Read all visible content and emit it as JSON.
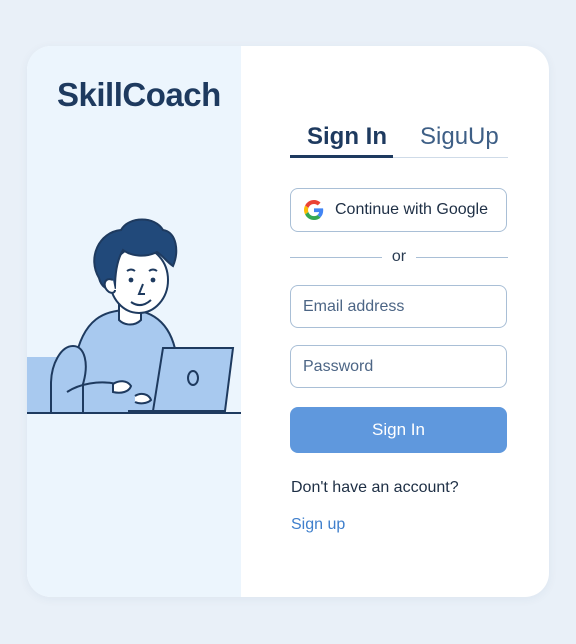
{
  "brand": {
    "name": "SkillCoach"
  },
  "tabs": [
    {
      "label": "Sign In",
      "active": true
    },
    {
      "label": "SiguUp",
      "active": false
    }
  ],
  "google_button": {
    "label": "Continue with Google",
    "icon": "google-g-icon"
  },
  "divider": {
    "text": "or"
  },
  "email": {
    "placeholder": "Email address",
    "value": ""
  },
  "password": {
    "placeholder": "Password",
    "value": ""
  },
  "signin_button": {
    "label": "Sign In"
  },
  "footer": {
    "prompt": "Don't have an account?",
    "link": "Sign up"
  },
  "colors": {
    "page_bg": "#e9f0f8",
    "panel_bg": "#ecf5fd",
    "brand": "#1e3a5f",
    "accent": "#5f98dd",
    "link": "#3f7fcc",
    "border": "#a9bfd6"
  }
}
